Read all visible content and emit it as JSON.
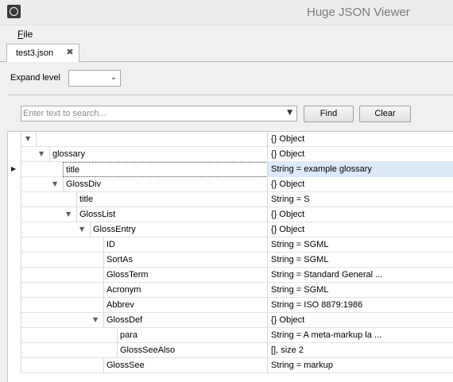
{
  "window": {
    "title": "Huge JSON Viewer"
  },
  "menu": {
    "file_label": "File"
  },
  "tabs": [
    {
      "label": "test3.json",
      "close_glyph": "✖"
    }
  ],
  "toolbar": {
    "expand_label": "Expand level",
    "expand_value": "",
    "search_placeholder": "Enter text to search...",
    "search_value": "",
    "find_label": "Find",
    "clear_label": "Clear"
  },
  "tree": {
    "rows": [
      {
        "depth": 0,
        "key": "",
        "value": "{} Object",
        "expandable": true,
        "expanded": true,
        "selected": false
      },
      {
        "depth": 1,
        "key": "glossary",
        "value": "{} Object",
        "expandable": true,
        "expanded": true,
        "selected": false
      },
      {
        "depth": 2,
        "key": "title",
        "value": "String = example glossary",
        "expandable": false,
        "expanded": false,
        "selected": true
      },
      {
        "depth": 2,
        "key": "GlossDiv",
        "value": "{} Object",
        "expandable": true,
        "expanded": true,
        "selected": false
      },
      {
        "depth": 3,
        "key": "title",
        "value": "String = S",
        "expandable": false,
        "expanded": false,
        "selected": false
      },
      {
        "depth": 3,
        "key": "GlossList",
        "value": "{} Object",
        "expandable": true,
        "expanded": true,
        "selected": false
      },
      {
        "depth": 4,
        "key": "GlossEntry",
        "value": "{} Object",
        "expandable": true,
        "expanded": true,
        "selected": false
      },
      {
        "depth": 5,
        "key": "ID",
        "value": "String = SGML",
        "expandable": false,
        "expanded": false,
        "selected": false
      },
      {
        "depth": 5,
        "key": "SortAs",
        "value": "String = SGML",
        "expandable": false,
        "expanded": false,
        "selected": false
      },
      {
        "depth": 5,
        "key": "GlossTerm",
        "value": "String = Standard General ...",
        "expandable": false,
        "expanded": false,
        "selected": false
      },
      {
        "depth": 5,
        "key": "Acronym",
        "value": "String = SGML",
        "expandable": false,
        "expanded": false,
        "selected": false
      },
      {
        "depth": 5,
        "key": "Abbrev",
        "value": "String = ISO 8879:1986",
        "expandable": false,
        "expanded": false,
        "selected": false
      },
      {
        "depth": 5,
        "key": "GlossDef",
        "value": "{} Object",
        "expandable": true,
        "expanded": true,
        "selected": false
      },
      {
        "depth": 6,
        "key": "para",
        "value": "String = A meta-markup la ...",
        "expandable": false,
        "expanded": false,
        "selected": false
      },
      {
        "depth": 6,
        "key": "GlossSeeAlso",
        "value": "[], size 2",
        "expandable": false,
        "expanded": false,
        "selected": false
      },
      {
        "depth": 5,
        "key": "GlossSee",
        "value": "String = markup",
        "expandable": false,
        "expanded": false,
        "selected": false
      }
    ]
  },
  "icons": {
    "expanded": "chevron-down-icon",
    "current_row": "row-pointer-icon",
    "dropdown": "chevron-down-icon",
    "app": "app-icon"
  }
}
